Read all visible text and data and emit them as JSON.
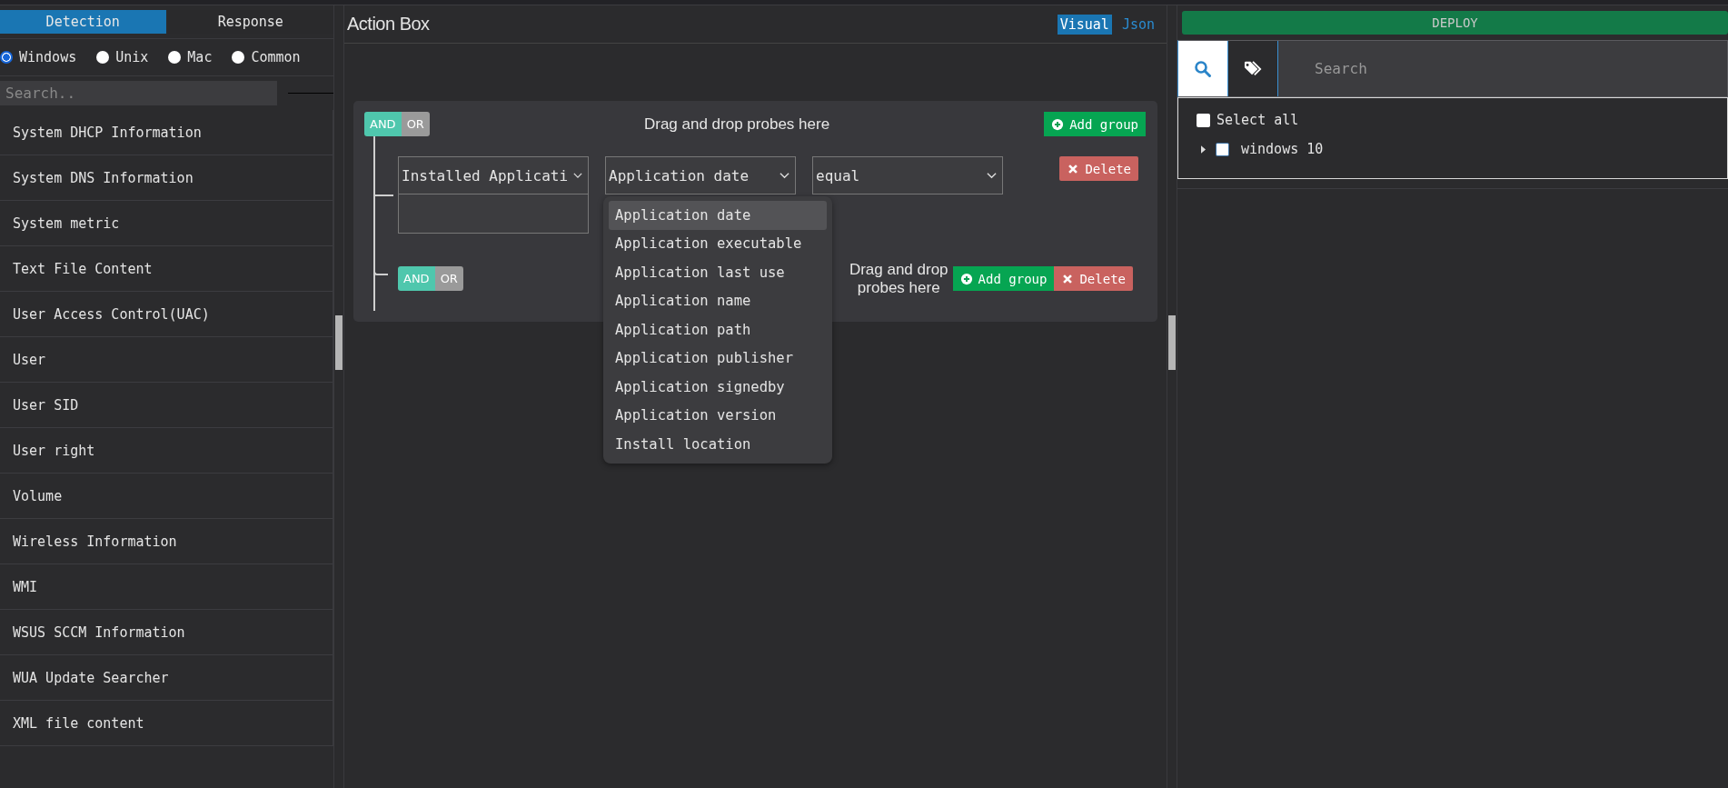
{
  "sidebar": {
    "tabs": [
      {
        "label": "Detection",
        "selected": true
      },
      {
        "label": "Response",
        "selected": false
      }
    ],
    "os_options": [
      {
        "label": "Windows",
        "selected": true
      },
      {
        "label": "Unix",
        "selected": false
      },
      {
        "label": "Mac",
        "selected": false
      },
      {
        "label": "Common",
        "selected": false
      }
    ],
    "search": {
      "placeholder": "Search.."
    },
    "items": [
      "System DHCP Information",
      "System DNS Information",
      "System metric",
      "Text File Content",
      "User Access Control(UAC)",
      "User",
      "User SID",
      "User right",
      "Volume",
      "Wireless Information",
      "WMI",
      "WSUS SCCM Information",
      "WUA Update Searcher",
      "XML file content"
    ]
  },
  "action_box": {
    "title": "Action Box",
    "view_tabs": [
      {
        "label": "Visual",
        "selected": true
      },
      {
        "label": "Json",
        "selected": false
      }
    ],
    "root_group": {
      "operators": [
        {
          "label": "AND",
          "selected": true
        },
        {
          "label": "OR",
          "selected": false
        }
      ],
      "drop_hint": "Drag and drop probes here",
      "add_group": "Add group",
      "rule": {
        "probe": "Installed Applicati",
        "field": "Application date",
        "operator": "equal",
        "delete": "Delete"
      },
      "subgroup": {
        "operators": [
          {
            "label": "AND",
            "selected": true
          },
          {
            "label": "OR",
            "selected": false
          }
        ],
        "drop_hint": "Drag and drop probes here",
        "add_group": "Add group",
        "delete": "Delete"
      }
    },
    "field_dropdown": {
      "options": [
        {
          "label": "Application date",
          "selected": true
        },
        {
          "label": "Application executable",
          "selected": false
        },
        {
          "label": "Application last use",
          "selected": false
        },
        {
          "label": "Application name",
          "selected": false
        },
        {
          "label": "Application path",
          "selected": false
        },
        {
          "label": "Application publisher",
          "selected": false
        },
        {
          "label": "Application signedby",
          "selected": false
        },
        {
          "label": "Application version",
          "selected": false
        },
        {
          "label": "Install location",
          "selected": false
        }
      ]
    }
  },
  "targets": {
    "deploy_button": "DEPLOY",
    "search_modes": [
      {
        "kind": "search",
        "selected": true
      },
      {
        "kind": "tag",
        "selected": false
      }
    ],
    "search": {
      "placeholder": "Search"
    },
    "select_all": {
      "label": "Select all",
      "checked": false
    },
    "tree": [
      {
        "label": "windows 10",
        "checked": false,
        "expanded": false
      }
    ]
  }
}
